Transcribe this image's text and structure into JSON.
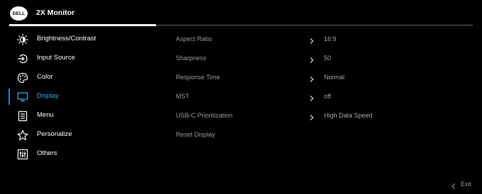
{
  "header": {
    "logo_text": "DELL",
    "title": "2X Monitor"
  },
  "menu": {
    "items": [
      {
        "label": "Brightness/Contrast",
        "icon": "brightness-icon",
        "active": false
      },
      {
        "label": "Input Source",
        "icon": "input-source-icon",
        "active": false
      },
      {
        "label": "Color",
        "icon": "color-palette-icon",
        "active": false
      },
      {
        "label": "Display",
        "icon": "display-monitor-icon",
        "active": true
      },
      {
        "label": "Menu",
        "icon": "menu-list-icon",
        "active": false
      },
      {
        "label": "Personalize",
        "icon": "star-icon",
        "active": false
      },
      {
        "label": "Others",
        "icon": "sliders-icon",
        "active": false
      }
    ]
  },
  "options": {
    "rows": [
      {
        "label": "Aspect Ratio",
        "value": "16:9",
        "has_submenu": true
      },
      {
        "label": "Sharpness",
        "value": "50",
        "has_submenu": true
      },
      {
        "label": "Response Time",
        "value": "Normal",
        "has_submenu": true
      },
      {
        "label": "MST",
        "value": "off",
        "has_submenu": true
      },
      {
        "label": "USB-C Prioritization",
        "value": "High Data Speed",
        "has_submenu": true
      },
      {
        "label": "Reset Display",
        "value": "",
        "has_submenu": false
      }
    ]
  },
  "footer": {
    "exit_label": "Exit"
  },
  "colors": {
    "background": "#000000",
    "accent": "#1e88d8",
    "active_text": "#3aa7e8",
    "muted_text": "#9a9a9a"
  }
}
